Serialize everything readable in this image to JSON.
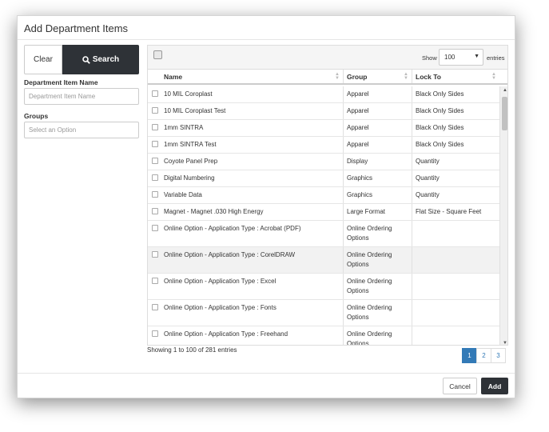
{
  "modal": {
    "title": "Add Department Items"
  },
  "filters": {
    "clear_label": "Clear",
    "search_label": "Search",
    "search_icon": "search-icon",
    "dept_item_name_label": "Department Item Name",
    "dept_item_name_placeholder": "Department Item Name",
    "groups_label": "Groups",
    "groups_placeholder": "Select an Option"
  },
  "table": {
    "show_label": "Show",
    "page_size": "100",
    "entries_label": "entries",
    "columns": [
      "Name",
      "Group",
      "Lock To"
    ],
    "rows": [
      {
        "name": "10 MIL Coroplast",
        "group": "Apparel",
        "lock": "Black Only Sides"
      },
      {
        "name": "10 MIL Coroplast Test",
        "group": "Apparel",
        "lock": "Black Only Sides"
      },
      {
        "name": "1mm SINTRA",
        "group": "Apparel",
        "lock": "Black Only Sides"
      },
      {
        "name": "1mm SINTRA Test",
        "group": "Apparel",
        "lock": "Black Only Sides"
      },
      {
        "name": "Coyote Panel Prep",
        "group": "Display",
        "lock": "Quantity"
      },
      {
        "name": "Digital Numbering",
        "group": "Graphics",
        "lock": "Quantity"
      },
      {
        "name": "Variable Data",
        "group": "Graphics",
        "lock": "Quantity"
      },
      {
        "name": "Magnet - Magnet .030 High Energy",
        "group": "Large Format",
        "lock": "Flat Size - Square Feet"
      },
      {
        "name": "Online Option - Application Type : Acrobat (PDF)",
        "group": "Online Ordering Options",
        "lock": ""
      },
      {
        "name": "Online Option - Application Type : CorelDRAW",
        "group": "Online Ordering Options",
        "lock": ""
      },
      {
        "name": "Online Option - Application Type : Excel",
        "group": "Online Ordering Options",
        "lock": ""
      },
      {
        "name": "Online Option - Application Type : Fonts",
        "group": "Online Ordering Options",
        "lock": ""
      },
      {
        "name": "Online Option - Application Type : Freehand",
        "group": "Online Ordering Options",
        "lock": ""
      }
    ],
    "showing_text": "Showing 1 to 100 of 281 entries",
    "pages": [
      "1",
      "2",
      "3"
    ],
    "active_page": "1"
  },
  "footer": {
    "cancel_label": "Cancel",
    "add_label": "Add"
  }
}
